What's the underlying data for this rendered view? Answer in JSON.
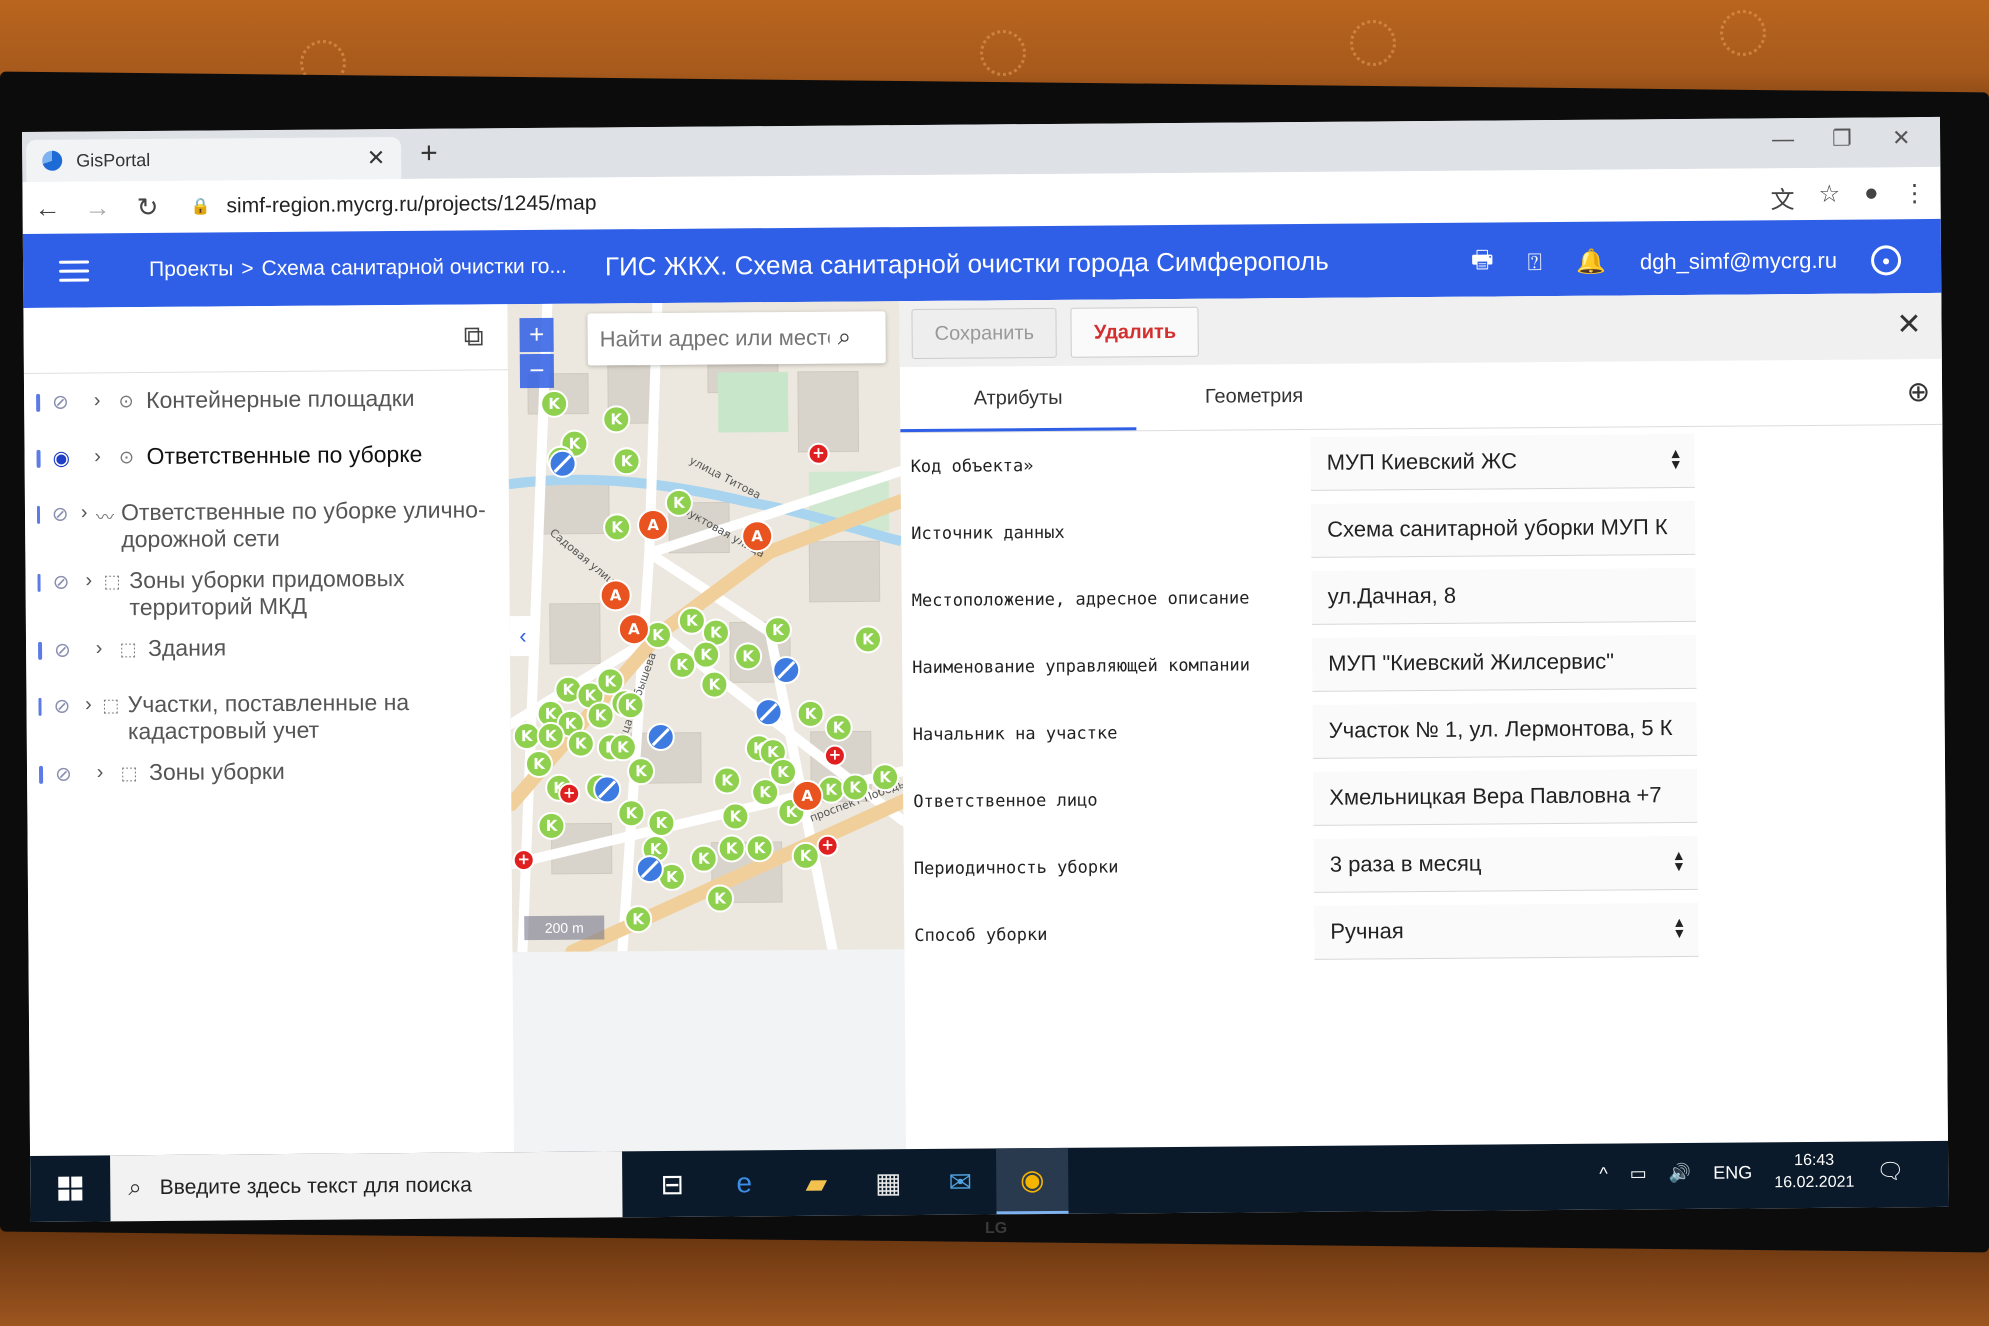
{
  "browser": {
    "tab_title": "GisPortal",
    "url": "simf-region.mycrg.ru/projects/1245/map"
  },
  "appbar": {
    "breadcrumb_root": "Проекты",
    "breadcrumb_sep": ">",
    "breadcrumb_current": "Схема санитарной очистки го...",
    "title": "ГИС ЖКХ. Схема санитарной очистки города Симферополь",
    "user": "dgh_simf@mycrg.ru"
  },
  "layers": [
    {
      "name": "Контейнерные площадки",
      "type": "point",
      "visible": false
    },
    {
      "name": "Ответственные по уборке",
      "type": "point",
      "visible": true
    },
    {
      "name": "Ответственные по уборке улично-дорожной сети",
      "type": "line",
      "visible": false
    },
    {
      "name": "Зоны уборки придомовых территорий МКД",
      "type": "polygon",
      "visible": false
    },
    {
      "name": "Здания",
      "type": "polygon",
      "visible": false
    },
    {
      "name": "Участки, поставленные на кадастровый учет",
      "type": "polygon",
      "visible": false
    },
    {
      "name": "Зоны уборки",
      "type": "polygon",
      "visible": false
    }
  ],
  "map": {
    "search_placeholder": "Найти адрес или место",
    "scale_label": "200 m",
    "streets": [
      "улица Титова",
      "Садовая улица",
      "улица Куйбышева",
      "проспект Победы",
      "Фруктовая улица"
    ],
    "marker_letters": {
      "k": "K",
      "a": "A"
    },
    "colors": {
      "k": "#8fd14f",
      "a": "#e8531f",
      "blue": "#3d7be0",
      "red": "#e02020"
    }
  },
  "attributes": {
    "save_label": "Сохранить",
    "delete_label": "Удалить",
    "tabs": [
      "Атрибуты",
      "Геометрия"
    ],
    "fields": [
      {
        "label": "Код объекта»",
        "value": "МУП Киевский ЖС",
        "select": true
      },
      {
        "label": "Источник данных",
        "value": "Схема санитарной уборки МУП К",
        "select": false
      },
      {
        "label": "Местоположение, адресное описание",
        "value": "ул.Дачная, 8",
        "select": false
      },
      {
        "label": "Наименование управляющей компании",
        "value": "МУП \"Киевский Жилсервис\"",
        "select": false
      },
      {
        "label": "Начальник на участке",
        "value": "Участок № 1, ул. Лермонтова, 5 К",
        "select": false
      },
      {
        "label": "Ответственное лицо",
        "value": "Хмельницкая Вера Павловна +7",
        "select": false
      },
      {
        "label": "Периодичность уборки",
        "value": "3 раза в месяц",
        "select": true
      },
      {
        "label": "Способ уборки",
        "value": "Ручная",
        "select": true
      }
    ]
  },
  "taskbar": {
    "search_text": "Введите здесь текст для поиска",
    "lang": "ENG",
    "time": "16:43",
    "date": "16.02.2021"
  },
  "monitor_brand": "LG"
}
